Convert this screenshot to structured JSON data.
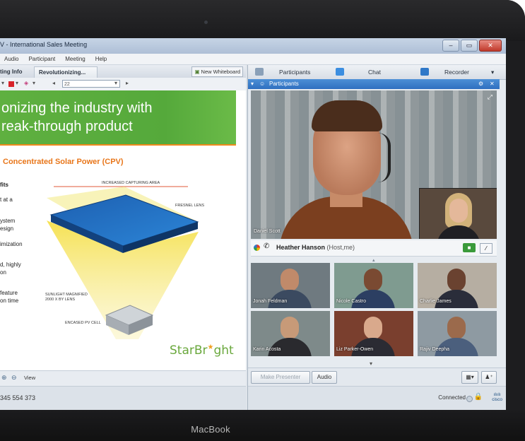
{
  "window": {
    "title": "V - International Sales Meeting",
    "controls": [
      "–",
      "▭",
      "✕"
    ]
  },
  "menu": [
    "Audio",
    "Participant",
    "Meeting",
    "Help"
  ],
  "content": {
    "tabs": [
      "ting Info",
      "Revolutionizing..."
    ],
    "new_whiteboard": "New Whiteboard",
    "page_field": "22",
    "slide": {
      "title_line1": "onizing the industry with",
      "title_line2": "reak-through product",
      "subtitle": "Concentrated Solar Power (CPV)",
      "bullets": [
        "fits",
        "t at a",
        "ystem",
        "esign",
        "imization",
        "d, highly",
        "on",
        "feature",
        "on time"
      ],
      "diagram_labels": {
        "increased_area": "INCREASED CAPTURING AREA",
        "fresnel": "FRESNEL LENS",
        "magnified": "SUNLIGHT MAGNIFIED 2000 X BY LENS",
        "pv_cell": "ENCASED PV CELL"
      },
      "logo_a": "StarBr",
      "logo_b": "ght"
    },
    "view_label": "View",
    "meeting_number": "345 554 373"
  },
  "panel": {
    "tabs": [
      "Participants",
      "Chat",
      "Recorder"
    ],
    "header": "Participants",
    "main_video_name": "Daniel Scott",
    "host": {
      "name": "Heather Hanson",
      "role": "(Host,me)"
    },
    "thumbnails": [
      {
        "name": "Jonah Feldman"
      },
      {
        "name": "Nicole Castro"
      },
      {
        "name": "Charlie James"
      },
      {
        "name": "Karin Acosta"
      },
      {
        "name": "Liz Parker-Owen"
      },
      {
        "name": "Rajiv Deepha"
      }
    ],
    "make_presenter": "Make Presenter",
    "audio": "Audio",
    "status": "Connected",
    "cisco": "cisco"
  },
  "device": {
    "brand": "MacBook"
  },
  "colors": {
    "green": "#5fb040",
    "orange": "#e8761a",
    "blue_header": "#2f6fc0"
  }
}
